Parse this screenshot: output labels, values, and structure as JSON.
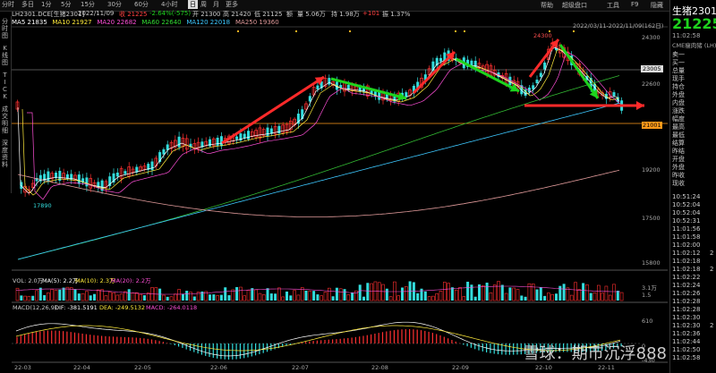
{
  "toolbar": {
    "periods": [
      "分时",
      "多日",
      "1分",
      "5分",
      "15分",
      "30分",
      "60分",
      "4小时",
      "日",
      "周",
      "月",
      "更多"
    ],
    "selected": "日",
    "right_tools": [
      "帮助",
      "超级盘口",
      "工具",
      "F9",
      "隐藏"
    ]
  },
  "left_tabs": [
    "分时图",
    "K线图",
    "TICK",
    "成交明细",
    "深度资料"
  ],
  "info": {
    "symbol": "LH2301.DCE[生猪2301]",
    "date": "2022/11/09",
    "close": "收 21225",
    "change": "-2.64%(-575)",
    "open": "开 21300",
    "high": "高 21420",
    "low": "低 21125",
    "turnover": "额",
    "volume": "量 5.06万",
    "oi": "持 1.98万",
    "oi_change": "+101",
    "amplitude": "振 1.37%"
  },
  "ma": [
    {
      "label": "MA5 21835",
      "color": "#ffffff"
    },
    {
      "label": "MA10 21927",
      "color": "#ffeb3b"
    },
    {
      "label": "MA20 22682",
      "color": "#ff4fd8"
    },
    {
      "label": "MA60 22640",
      "color": "#33dd33"
    },
    {
      "label": "MA120 22018",
      "color": "#3dc8ff"
    },
    {
      "label": "MA250 19360",
      "color": "#e09a9a"
    }
  ],
  "range_label": "2022/03/11-2022/11/09(162日)",
  "price_labels": {
    "high": "24300",
    "low": "17890",
    "current": "21225",
    "ref": "23005",
    "cur_box": "21001"
  },
  "y_ticks": [
    "24300",
    "22600",
    "21001",
    "19200",
    "17500",
    "15800"
  ],
  "x_ticks": [
    "22-03",
    "22-04",
    "22-05",
    "22-06",
    "22-07",
    "22-08",
    "22-09",
    "22-10",
    "22-11"
  ],
  "vol_label": {
    "vol": "VOL: 2.0万",
    "ma5": "MA(5): 2.2万",
    "ma10": "MA(10): 2.3万",
    "ma20": "MA(20): 2.2万"
  },
  "vol_axis": [
    "3.1万",
    "1.5"
  ],
  "macd_label": {
    "title": "MACD(12,26,9)",
    "dif": "DIF: -381.5191",
    "dea": "DEA: -249.5132",
    "macd": "MACD: -264.0118"
  },
  "macd_axis": [
    "610",
    "0",
    "-430"
  ],
  "right_panel": {
    "name": "生猪2301",
    "price": "21225",
    "time": "11:02:58",
    "exchange": "CME瘦肉猪 (LH)",
    "rows": [
      "卖一",
      "买一",
      "总量",
      "现手",
      "持仓",
      "外盘",
      "内盘",
      "涨跌",
      "幅度",
      "最高",
      "最低",
      "结算",
      "昨结",
      "开盘",
      "外盘",
      "昨收",
      "现收"
    ],
    "ticks": [
      "10:51:24",
      "10:52:04",
      "10:52:04",
      "10:52:31",
      "11:01:56",
      "11:01:58",
      "11:02:00",
      "11:02:12",
      "11:02:18",
      "11:02:18",
      "11:02:22",
      "11:02:24",
      "11:02:26",
      "11:02:28",
      "11:02:28",
      "11:02:30",
      "11:02:30",
      "11:02:36",
      "11:02:44",
      "11:02:50",
      "11:02:58"
    ],
    "tick_vals": [
      "",
      "",
      "",
      "",
      "",
      "",
      "",
      "2",
      "",
      "2",
      "",
      "",
      "",
      "",
      "",
      "",
      "2",
      "",
      "",
      "",
      ""
    ]
  },
  "watermark": "雪球：期市沉浮888",
  "colors": {
    "up": "#ff3030",
    "down": "#33dddd",
    "green_arrow": "#1ed31e",
    "red_arrow": "#ff2a2a"
  }
}
